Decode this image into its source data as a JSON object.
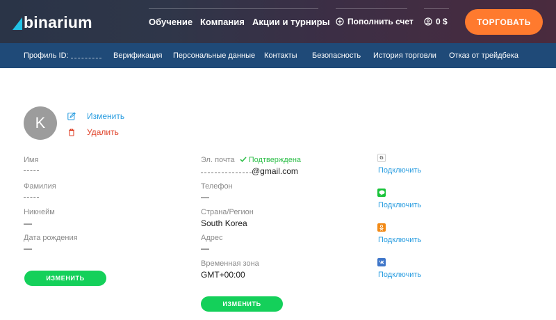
{
  "brand": {
    "name": "binarium",
    "accent": "#14d05a",
    "cta_color": "#ff7a2e",
    "link_color": "#2a9de0",
    "danger_color": "#e0452c"
  },
  "topnav": {
    "items": [
      "Обучение",
      "Компания",
      "Акции и турниры"
    ],
    "deposit_label": "Пополнить счет",
    "deposit_icon": "plus-circle-icon",
    "balance_label": "0 $",
    "balance_icon": "user-circle-icon",
    "trade_label": "ТОРГОВАТЬ"
  },
  "subnav": {
    "profile_id_label": "Профиль ID:",
    "items": [
      "Верификация",
      "Персональные данные",
      "Контакты",
      "Безопасность",
      "История торговли",
      "Отказ от трейдбека"
    ]
  },
  "avatar": {
    "initial": "K",
    "edit_label": "Изменить",
    "edit_icon": "edit-icon",
    "delete_label": "Удалить",
    "delete_icon": "trash-icon"
  },
  "personal": {
    "name_label": "Имя",
    "surname_label": "Фамилия",
    "nickname_label": "Никнейм",
    "nickname_value": "—",
    "birthdate_label": "Дата рождения",
    "birthdate_value": "—",
    "edit_button": "ИЗМЕНИТЬ"
  },
  "contacts": {
    "email_label": "Эл. почта",
    "email_status": "Подтверждена",
    "email_suffix": "@gmail.com",
    "phone_label": "Телефон",
    "phone_value": "—",
    "country_label": "Страна/Регион",
    "country_value": "South Korea",
    "address_label": "Адрес",
    "address_value": "—",
    "timezone_label": "Временная зона",
    "timezone_value": "GMT+00:00",
    "edit_button": "ИЗМЕНИТЬ"
  },
  "social": {
    "connect_label": "Подключить",
    "items": [
      {
        "network": "google",
        "icon": "google-icon",
        "glyph": "G",
        "color": "#ffffff"
      },
      {
        "network": "line",
        "icon": "line-icon",
        "glyph": "",
        "color": "#19c33a"
      },
      {
        "network": "odnoklassniki",
        "icon": "odnoklassniki-icon",
        "glyph": "",
        "color": "#f28a16"
      },
      {
        "network": "vk",
        "icon": "vk-icon",
        "glyph": "",
        "color": "#3f76c9"
      }
    ]
  }
}
